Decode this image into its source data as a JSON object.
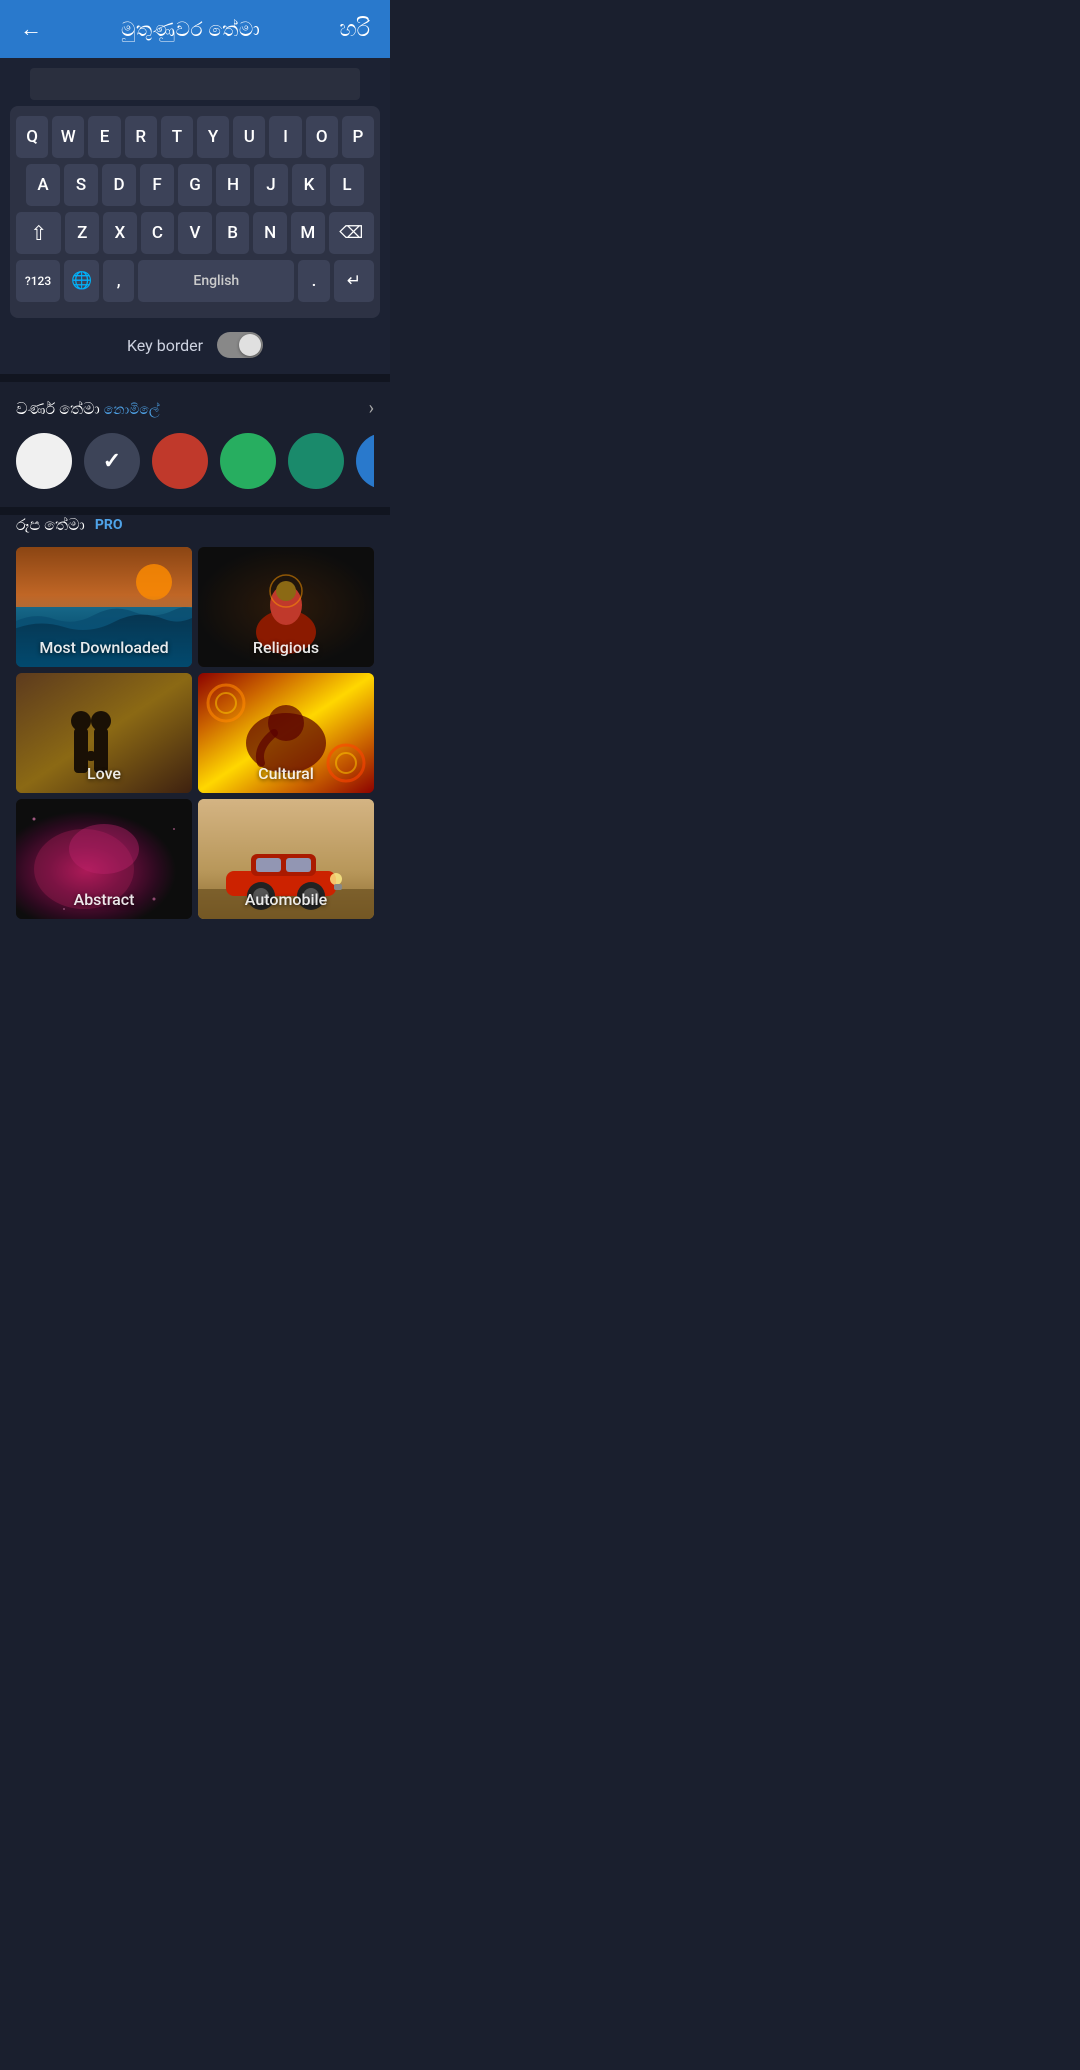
{
  "header": {
    "back_icon": "←",
    "title": "මුතුණුවර තේමා",
    "ok_label": "හරි"
  },
  "keyboard": {
    "rows": [
      [
        "Q",
        "W",
        "E",
        "R",
        "T",
        "Y",
        "U",
        "I",
        "O",
        "P"
      ],
      [
        "A",
        "S",
        "D",
        "F",
        "G",
        "H",
        "J",
        "K",
        "L"
      ],
      [
        "⇧",
        "Z",
        "X",
        "C",
        "V",
        "B",
        "N",
        "M",
        "⌫"
      ],
      [
        "?123",
        "🌐",
        ",",
        "English",
        ".",
        "↵"
      ]
    ],
    "key_border_label": "Key border"
  },
  "color_section": {
    "title": "වර්ණ තේමා",
    "highlight": "නොමිලේ",
    "chevron": "›",
    "swatches": [
      {
        "color": "#f0f0f0",
        "selected": false
      },
      {
        "color": "#3d4458",
        "selected": true
      },
      {
        "color": "#c0392b",
        "selected": false
      },
      {
        "color": "#27ae60",
        "selected": false
      },
      {
        "color": "#1a8a6b",
        "selected": false
      },
      {
        "color": "#2979cc",
        "selected": false
      }
    ]
  },
  "image_section": {
    "title": "රූප තේමා",
    "pro_badge": "PRO",
    "themes": [
      {
        "label": "Most Downloaded",
        "bg_class": "bg-ocean"
      },
      {
        "label": "Religious",
        "bg_class": "bg-religious"
      },
      {
        "label": "Love",
        "bg_class": "bg-love"
      },
      {
        "label": "Cultural",
        "bg_class": "bg-cultural"
      },
      {
        "label": "Abstract",
        "bg_class": "bg-abstract"
      },
      {
        "label": "Automobile",
        "bg_class": "bg-automobile"
      }
    ]
  }
}
